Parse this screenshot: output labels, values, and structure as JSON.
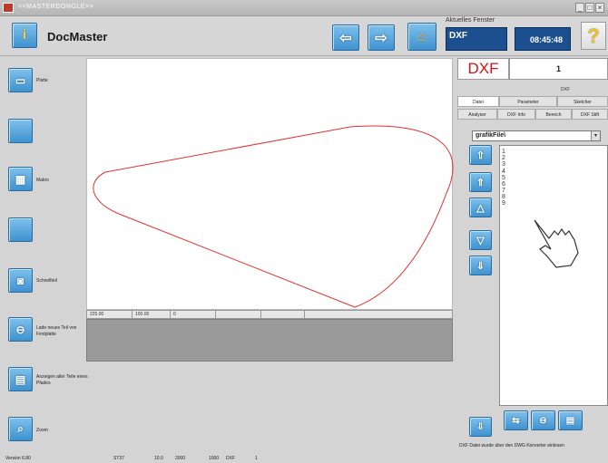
{
  "window": {
    "title": "<<MASTERDONGLE>>",
    "minimize": "_",
    "maximize": "□",
    "close": "×"
  },
  "header": {
    "app_name": "DocMaster",
    "aktuelles_fenster_label": "Aktuelles Fenster",
    "aktuelles_fenster_value": "DXF",
    "clock": "08:45:48",
    "help_glyph": "?",
    "info_glyph": "i",
    "back_glyph": "⇦",
    "forward_glyph": "⇨",
    "home_glyph": "⌂"
  },
  "sidebar": {
    "items": [
      {
        "label": "Platte",
        "icon": "sheet-icon",
        "glyph": "▭"
      },
      {
        "label": "",
        "icon": "",
        "glyph": ""
      },
      {
        "label": "Makro",
        "icon": "macro-icon",
        "glyph": "▦"
      },
      {
        "label": "",
        "icon": "",
        "glyph": ""
      },
      {
        "label": "Schnellteil",
        "icon": "quickpart-icon",
        "glyph": "◙"
      },
      {
        "label": "Lade neues Teil von Festplatte",
        "icon": "load-disk-icon",
        "glyph": "⊖"
      },
      {
        "label": "Anzeigen aller Teile eines Pfades",
        "icon": "show-path-parts-icon",
        "glyph": "▤"
      },
      {
        "label": "Zoom",
        "icon": "zoom-icon",
        "glyph": "⌕"
      }
    ]
  },
  "canvas": {
    "status": [
      "225.00",
      "100.00",
      "0",
      "",
      ""
    ]
  },
  "right": {
    "file_type": "DXF",
    "count": "1",
    "tabs_row1": [
      "Datei",
      "Parameter",
      "Sketcher"
    ],
    "tab_dxf_top": "DXF",
    "tabs_row2": [
      "Analyser",
      "DXF Info",
      "Bereich",
      "DXF Stift"
    ],
    "path_value": "grafikFile\\",
    "path_arrow": "▾",
    "file_numbers": [
      "1",
      "2",
      "3",
      "4",
      "5",
      "6",
      "7",
      "8",
      "9"
    ],
    "arrow_glyphs": [
      "⇧",
      "⇑",
      "△",
      "▽",
      "⇓"
    ],
    "bottom_glyphs": [
      "⇩",
      "⇆",
      "⊖",
      "▤"
    ],
    "status_message": "DXF Datei wurde über den DWG Konverter einlesen"
  },
  "footer": {
    "version": "Version 6.80",
    "material": "ST37",
    "thickness": "10.0",
    "dim_x": "2000",
    "dim_y": "1000",
    "type": "DXF",
    "count": "1"
  }
}
